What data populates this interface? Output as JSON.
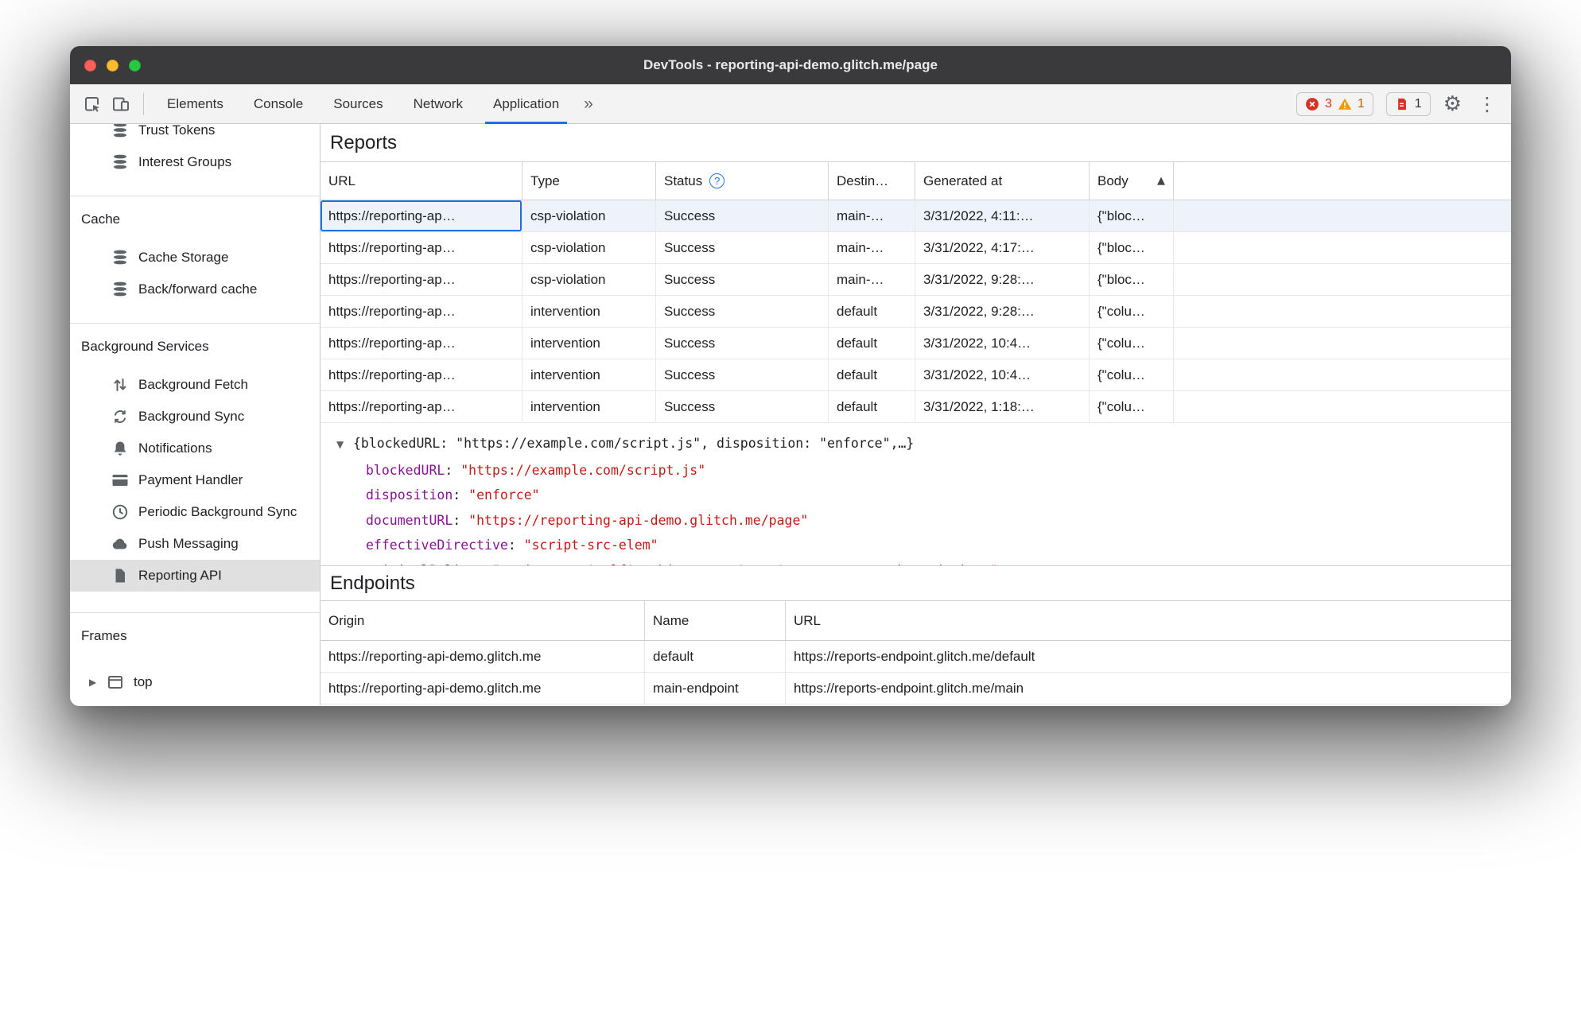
{
  "window_title": "DevTools - reporting-api-demo.glitch.me/page",
  "toolbar": {
    "tabs": [
      "Elements",
      "Console",
      "Sources",
      "Network",
      "Application"
    ],
    "selected_tab": "Application",
    "more_tabs": "»",
    "error_count": "3",
    "warning_count": "1",
    "issues_count": "1"
  },
  "sidebar": {
    "items_top": [
      {
        "label": "Trust Tokens"
      },
      {
        "label": "Interest Groups"
      }
    ],
    "cache_section": {
      "title": "Cache",
      "items": [
        {
          "label": "Cache Storage"
        },
        {
          "label": "Back/forward cache"
        }
      ]
    },
    "background_section": {
      "title": "Background Services",
      "items": [
        {
          "label": "Background Fetch"
        },
        {
          "label": "Background Sync"
        },
        {
          "label": "Notifications"
        },
        {
          "label": "Payment Handler"
        },
        {
          "label": "Periodic Background Sync"
        },
        {
          "label": "Push Messaging"
        },
        {
          "label": "Reporting API",
          "selected": true
        }
      ]
    },
    "frames_section": {
      "title": "Frames",
      "items": [
        {
          "label": "top"
        }
      ]
    }
  },
  "reports": {
    "title": "Reports",
    "columns": {
      "url": "URL",
      "type": "Type",
      "status": "Status",
      "destination": "Destin…",
      "generated": "Generated at",
      "body": "Body"
    },
    "rows": [
      {
        "url": "https://reporting-ap…",
        "type": "csp-violation",
        "status": "Success",
        "destination": "main-…",
        "generated": "3/31/2022, 4:11:…",
        "body": "{\"bloc…"
      },
      {
        "url": "https://reporting-ap…",
        "type": "csp-violation",
        "status": "Success",
        "destination": "main-…",
        "generated": "3/31/2022, 4:17:…",
        "body": "{\"bloc…"
      },
      {
        "url": "https://reporting-ap…",
        "type": "csp-violation",
        "status": "Success",
        "destination": "main-…",
        "generated": "3/31/2022, 9:28:…",
        "body": "{\"bloc…"
      },
      {
        "url": "https://reporting-ap…",
        "type": "intervention",
        "status": "Success",
        "destination": "default",
        "generated": "3/31/2022, 9:28:…",
        "body": "{\"colu…"
      },
      {
        "url": "https://reporting-ap…",
        "type": "intervention",
        "status": "Success",
        "destination": "default",
        "generated": "3/31/2022, 10:4…",
        "body": "{\"colu…"
      },
      {
        "url": "https://reporting-ap…",
        "type": "intervention",
        "status": "Success",
        "destination": "default",
        "generated": "3/31/2022, 10:4…",
        "body": "{\"colu…"
      },
      {
        "url": "https://reporting-ap…",
        "type": "intervention",
        "status": "Success",
        "destination": "default",
        "generated": "3/31/2022, 1:18:…",
        "body": "{\"colu…"
      }
    ],
    "preview": {
      "summary": "{blockedURL: \"https://example.com/script.js\", disposition: \"enforce\",…}",
      "props": [
        {
          "name": "blockedURL",
          "value": "\"https://example.com/script.js\""
        },
        {
          "name": "disposition",
          "value": "\"enforce\""
        },
        {
          "name": "documentURL",
          "value": "\"https://reporting-api-demo.glitch.me/page\""
        },
        {
          "name": "effectiveDirective",
          "value": "\"script-src-elem\""
        },
        {
          "name": "originalPolicy",
          "value": "\"script-src 'self'; object-src 'none'; report-to main-endpoint;\""
        }
      ]
    }
  },
  "endpoints": {
    "title": "Endpoints",
    "columns": {
      "origin": "Origin",
      "name": "Name",
      "url": "URL"
    },
    "rows": [
      {
        "origin": "https://reporting-api-demo.glitch.me",
        "name": "default",
        "url": "https://reports-endpoint.glitch.me/default"
      },
      {
        "origin": "https://reporting-api-demo.glitch.me",
        "name": "main-endpoint",
        "url": "https://reports-endpoint.glitch.me/main"
      }
    ]
  },
  "colors": {
    "accent": "#1a73e8",
    "error": "#d93025",
    "warning": "#f29900",
    "json_key": "#881391",
    "json_string": "#c41a16",
    "selected_row_bg": "#edf2fb",
    "sidebar_selected_bg": "#e0e0e0",
    "titlebar_bg": "#3a3a3c"
  }
}
